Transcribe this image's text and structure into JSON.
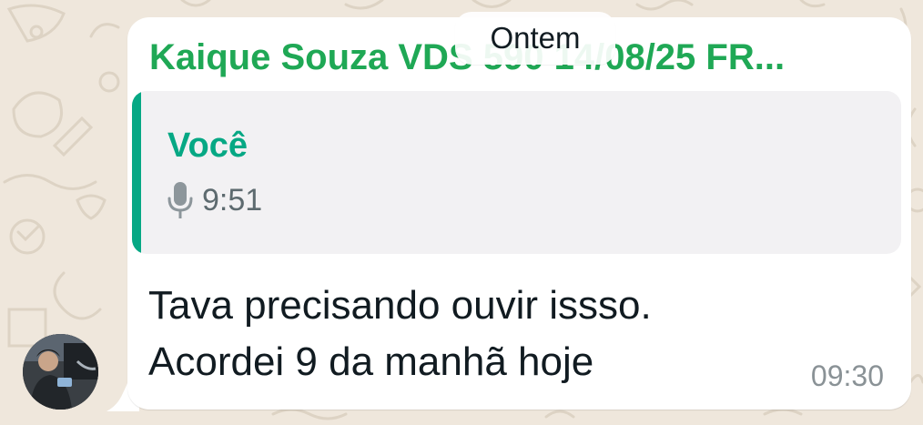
{
  "chat": {
    "date_separator": "Ontem"
  },
  "message": {
    "sender_name": "Kaique Souza VDS 590 14/08/25 FR...",
    "sender_color": "#1fa855",
    "quote": {
      "author": "Você",
      "author_color": "#06a884",
      "icon": "mic-icon",
      "audio_duration": "9:51"
    },
    "text_lines": [
      "Tava precisando ouvir issso.",
      "Acordei 9 da manhã hoje"
    ],
    "time": "09:30"
  },
  "avatar": {
    "icon": "avatar"
  }
}
